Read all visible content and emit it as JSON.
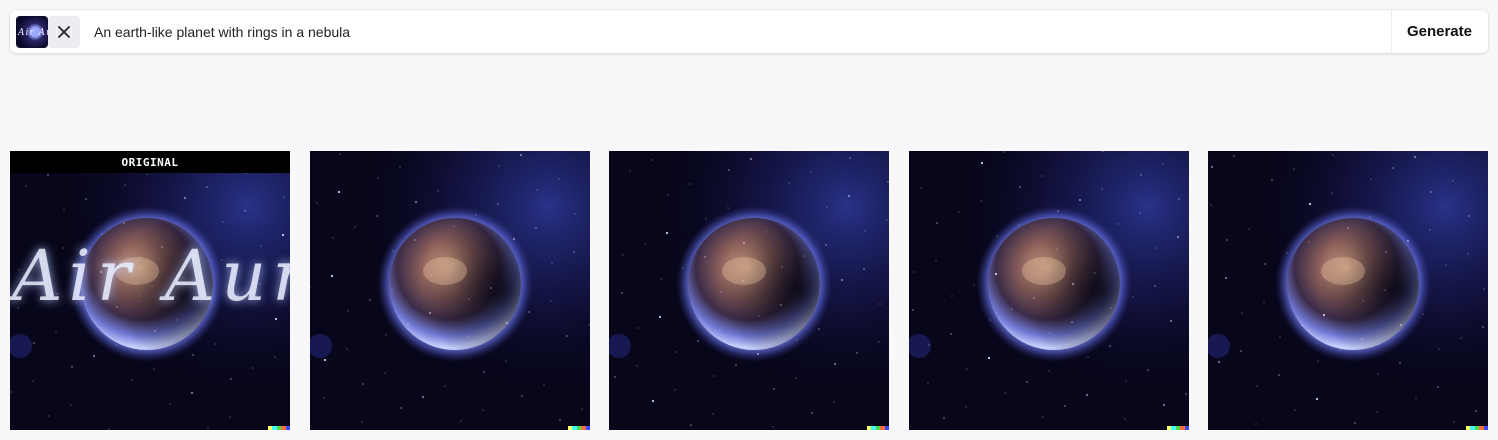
{
  "prompt_bar": {
    "thumbnail_text": "Air Aura",
    "prompt": "An earth-like planet with rings in a nebula",
    "generate_label": "Generate"
  },
  "gallery": {
    "original_label": "ORIGINAL",
    "original_overlay_text": "Air Aura",
    "tiles": [
      {
        "kind": "original"
      },
      {
        "kind": "variation"
      },
      {
        "kind": "variation"
      },
      {
        "kind": "variation"
      },
      {
        "kind": "variation"
      }
    ]
  },
  "colors": {
    "background": "#f8f8fa",
    "watermark": [
      "#ffff66",
      "#42ffff",
      "#51da4c",
      "#ff6e3c",
      "#3c46ff"
    ]
  },
  "icons": {
    "close": "close-icon"
  }
}
